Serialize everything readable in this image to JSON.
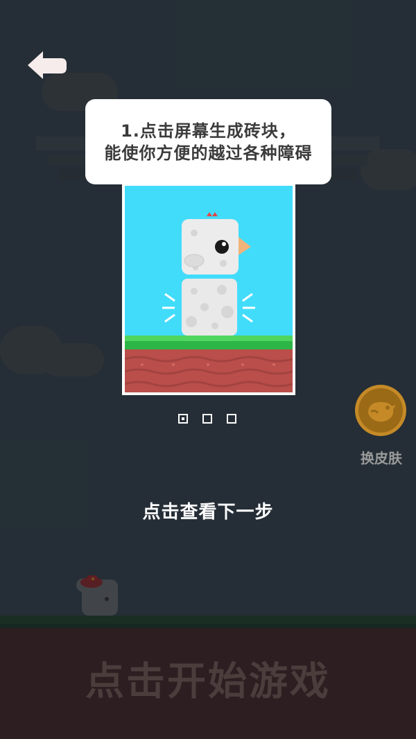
{
  "tutorial": {
    "tip_line1": "1.点击屏幕生成砖块，",
    "tip_line2": "能使你方便的越过各种障碍",
    "page_indicator": {
      "total": 3,
      "active": 1
    }
  },
  "next_step_label": "点击查看下一步",
  "skin_button_label": "换皮肤",
  "start_game_label": "点击开始游戏",
  "icons": {
    "back": "back-arrow-icon",
    "skin": "bird-icon"
  },
  "colors": {
    "background": "#2e3a43",
    "tutorial_sky": "#42dcfb",
    "skin_button": "#c58a27",
    "start_text": "#4a3d3c"
  }
}
